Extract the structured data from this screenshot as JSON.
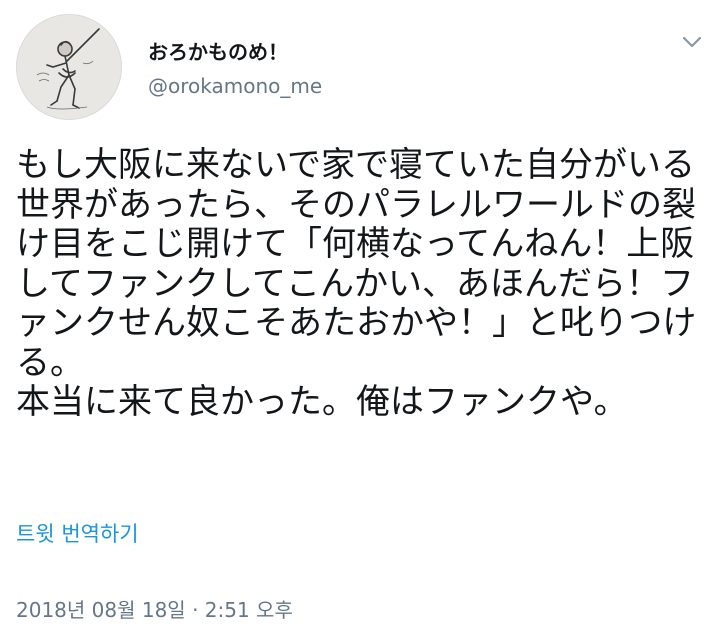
{
  "user": {
    "display_name": "おろかものめ！",
    "handle": "@orokamono_me",
    "avatar_icon": "avatar-sketch-figure"
  },
  "menu": {
    "caret_icon": "chevron-down-icon"
  },
  "tweet": {
    "text": "もし大阪に来ないで家で寝ていた自分がいる世界があったら、そのパラレルワールドの裂け目をこじ開けて「何横なってんねん！上阪してファンクしてこんかい、あほんだら！ファンクせん奴こそあたおかや！」と叱りつける。\n本当に来て良かった。俺はファンクや。",
    "translate_label": "트윗 번역하기",
    "timestamp": "2018년 08월 18일 · 2:51 오후"
  },
  "colors": {
    "text": "#14171a",
    "secondary": "#657786",
    "link": "#1b95e0"
  }
}
